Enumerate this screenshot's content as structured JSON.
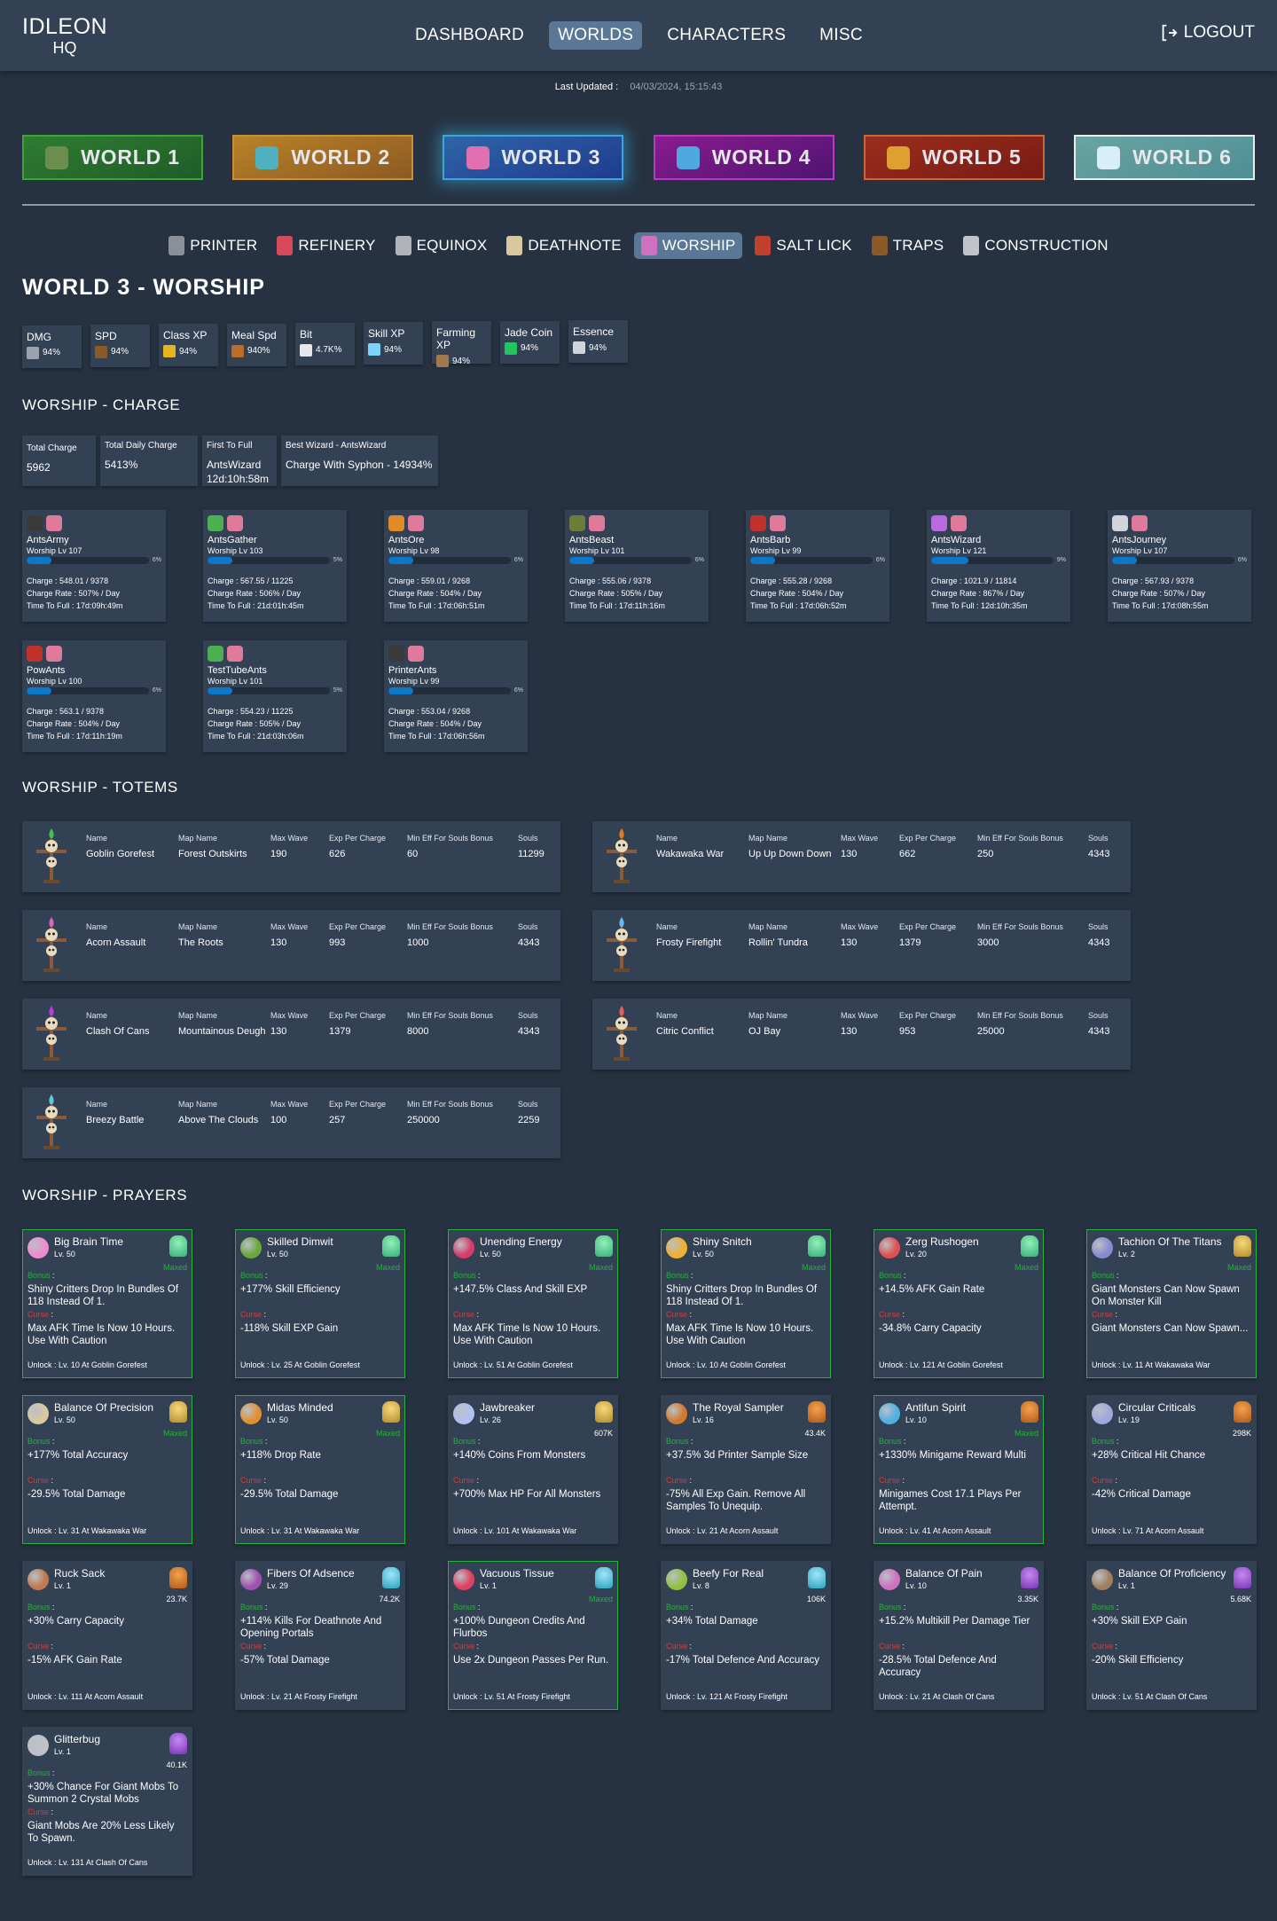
{
  "header": {
    "logo_line1": "IDLEON",
    "logo_line2": "HQ",
    "nav": [
      "DASHBOARD",
      "WORLDS",
      "CHARACTERS",
      "MISC"
    ],
    "active_nav": "WORLDS",
    "logout_label": "LOGOUT",
    "last_updated_label": "Last Updated :",
    "last_updated_value": "04/03/2024, 15:15:43"
  },
  "worlds": [
    "WORLD 1",
    "WORLD 2",
    "WORLD 3",
    "WORLD 4",
    "WORLD 5",
    "WORLD 6"
  ],
  "active_world": "WORLD 3",
  "subnav": [
    "PRINTER",
    "REFINERY",
    "EQUINOX",
    "DEATHNOTE",
    "WORSHIP",
    "SALT LICK",
    "TRAPS",
    "CONSTRUCTION"
  ],
  "active_subnav": "WORSHIP",
  "page_title": "WORLD 3 - WORSHIP",
  "bonuses": [
    {
      "label": "DMG",
      "value": "94%",
      "icon": "axe-icon",
      "color": "#9ca3af"
    },
    {
      "label": "SPD",
      "value": "94%",
      "icon": "basket-icon",
      "color": "#8b5a2b"
    },
    {
      "label": "Class XP",
      "value": "94%",
      "icon": "xp-icon",
      "color": "#e6b422"
    },
    {
      "label": "Meal Spd",
      "value": "940%",
      "icon": "meal-icon",
      "color": "#c06a2a"
    },
    {
      "label": "Bit",
      "value": "4.7K%",
      "icon": "bit-icon",
      "color": "#e5e7eb"
    },
    {
      "label": "Skill XP",
      "value": "94%",
      "icon": "skill-xp-icon",
      "color": "#7dd3fc"
    },
    {
      "label": "Farming XP",
      "value": "94%",
      "icon": "farming-icon",
      "color": "#a3784b"
    },
    {
      "label": "Jade Coin",
      "value": "94%",
      "icon": "jade-coin-icon",
      "color": "#22c55e"
    },
    {
      "label": "Essence",
      "value": "94%",
      "icon": "essence-icon",
      "color": "#d1d5db"
    }
  ],
  "charge": {
    "section_title": "WORSHIP - CHARGE",
    "summary": [
      {
        "label": "Total Charge",
        "value": "5962"
      },
      {
        "label": "Total Daily Charge",
        "value": "5413%"
      },
      {
        "label": "First To Full",
        "value": "AntsWizard",
        "value2": "12d:10h:58m"
      },
      {
        "label": "Best Wizard - AntsWizard",
        "value": "Charge With Syphon - 14934%"
      }
    ],
    "characters": [
      {
        "name": "AntsArmy",
        "level": "Worship Lv 107",
        "progress": 6,
        "pct": "6%",
        "charge": "Charge : 548.01 / 9378",
        "rate": "Charge Rate : 507% / Day",
        "full": "Time To Full : 17d:09h:49m",
        "class_color": "#3a3a3a"
      },
      {
        "name": "AntsGather",
        "level": "Worship Lv 103",
        "progress": 5,
        "pct": "5%",
        "charge": "Charge : 567.55 / 11225",
        "rate": "Charge Rate : 506% / Day",
        "full": "Time To Full : 21d:01h:45m",
        "class_color": "#4caf50"
      },
      {
        "name": "AntsOre",
        "level": "Worship Lv 98",
        "progress": 6,
        "pct": "6%",
        "charge": "Charge : 559.01 / 9268",
        "rate": "Charge Rate : 504% / Day",
        "full": "Time To Full : 17d:06h:51m",
        "class_color": "#e08a2a"
      },
      {
        "name": "AntsBeast",
        "level": "Worship Lv 101",
        "progress": 6,
        "pct": "6%",
        "charge": "Charge : 555.06 / 9378",
        "rate": "Charge Rate : 505% / Day",
        "full": "Time To Full : 17d:11h:16m",
        "class_color": "#6b7d3a"
      },
      {
        "name": "AntsBarb",
        "level": "Worship Lv 99",
        "progress": 6,
        "pct": "6%",
        "charge": "Charge : 555.28 / 9268",
        "rate": "Charge Rate : 504% / Day",
        "full": "Time To Full : 17d:06h:52m",
        "class_color": "#c2322d"
      },
      {
        "name": "AntsWizard",
        "level": "Worship Lv 121",
        "progress": 9,
        "pct": "9%",
        "charge": "Charge : 1021.9 / 11814",
        "rate": "Charge Rate : 867% / Day",
        "full": "Time To Full : 12d:10h:35m",
        "class_color": "#b86ae0"
      },
      {
        "name": "AntsJourney",
        "level": "Worship Lv 107",
        "progress": 6,
        "pct": "6%",
        "charge": "Charge : 567.93 / 9378",
        "rate": "Charge Rate : 507% / Day",
        "full": "Time To Full : 17d:08h:55m",
        "class_color": "#d1d5db"
      },
      {
        "name": "PowAnts",
        "level": "Worship Lv 100",
        "progress": 6,
        "pct": "6%",
        "charge": "Charge : 563.1 / 9378",
        "rate": "Charge Rate : 504% / Day",
        "full": "Time To Full : 17d:11h:19m",
        "class_color": "#c2322d"
      },
      {
        "name": "TestTubeAnts",
        "level": "Worship Lv 101",
        "progress": 5,
        "pct": "5%",
        "charge": "Charge : 554.23 / 11225",
        "rate": "Charge Rate : 505% / Day",
        "full": "Time To Full : 21d:03h:06m",
        "class_color": "#4caf50"
      },
      {
        "name": "PrinterAnts",
        "level": "Worship Lv 99",
        "progress": 6,
        "pct": "6%",
        "charge": "Charge : 553.04 / 9268",
        "rate": "Charge Rate : 504% / Day",
        "full": "Time To Full : 17d:06h:56m",
        "class_color": "#3a3a3a"
      }
    ]
  },
  "totems": {
    "section_title": "WORSHIP - TOTEMS",
    "headers": [
      "Name",
      "Map Name",
      "Max Wave",
      "Exp Per Charge",
      "Min Eff For Souls Bonus",
      "Souls"
    ],
    "items": [
      {
        "name": "Goblin Gorefest",
        "map": "Forest Outskirts",
        "max_wave": "190",
        "exp": "626",
        "min_eff": "60",
        "souls": "11299",
        "flame": "#3fbf5a"
      },
      {
        "name": "Wakawaka War",
        "map": "Up Up Down Down",
        "max_wave": "130",
        "exp": "662",
        "min_eff": "250",
        "souls": "4343",
        "flame": "#e07a2a"
      },
      {
        "name": "Acorn Assault",
        "map": "The Roots",
        "max_wave": "130",
        "exp": "993",
        "min_eff": "1000",
        "souls": "4343",
        "flame": "#e060c0"
      },
      {
        "name": "Frosty Firefight",
        "map": "Rollin' Tundra",
        "max_wave": "130",
        "exp": "1379",
        "min_eff": "3000",
        "souls": "4343",
        "flame": "#6ab8f0"
      },
      {
        "name": "Clash Of Cans",
        "map": "Mountainous Deugh",
        "max_wave": "130",
        "exp": "1379",
        "min_eff": "8000",
        "souls": "4343",
        "flame": "#b040e0"
      },
      {
        "name": "Citric Conflict",
        "map": "OJ Bay",
        "max_wave": "130",
        "exp": "953",
        "min_eff": "25000",
        "souls": "4343",
        "flame": "#e06060"
      },
      {
        "name": "Breezy Battle",
        "map": "Above The Clouds",
        "max_wave": "100",
        "exp": "257",
        "min_eff": "250000",
        "souls": "2259",
        "flame": "#5ac8e0"
      }
    ]
  },
  "prayers": {
    "section_title": "WORSHIP - PRAYERS",
    "bonus_label": "Bonus",
    "curse_label": "Curse",
    "unlock_label": "Unlock :",
    "maxed_label": "Maxed",
    "items": [
      {
        "name": "Big Brain Time",
        "level": "Lv. 50",
        "maxed": true,
        "cost": "Maxed",
        "soul": "green",
        "orb": "#f08ad0",
        "bonus": "Shiny Critters Drop In Bundles Of 118 Instead Of 1.",
        "curse": "Max AFK Time Is Now 10 Hours. Use With Caution",
        "unlock": "Lv. 10 At Goblin Gorefest"
      },
      {
        "name": "Skilled Dimwit",
        "level": "Lv. 50",
        "maxed": true,
        "cost": "Maxed",
        "soul": "green",
        "orb": "#6aa83a",
        "bonus": "+177% Skill Efficiency",
        "curse": "-118% Skill EXP Gain",
        "unlock": "Lv. 25 At Goblin Gorefest"
      },
      {
        "name": "Unending Energy",
        "level": "Lv. 50",
        "maxed": true,
        "cost": "Maxed",
        "soul": "green",
        "orb": "#d63c6a",
        "bonus": "+147.5% Class And Skill EXP",
        "curse": "Max AFK Time Is Now 10 Hours. Use With Caution",
        "unlock": "Lv. 51 At Goblin Gorefest"
      },
      {
        "name": "Shiny Snitch",
        "level": "Lv. 50",
        "maxed": true,
        "cost": "Maxed",
        "soul": "green",
        "orb": "#f0b030",
        "bonus": "Shiny Critters Drop In Bundles Of 118 Instead Of 1.",
        "curse": "Max AFK Time Is Now 10 Hours. Use With Caution",
        "unlock": "Lv. 10 At Goblin Gorefest"
      },
      {
        "name": "Zerg Rushogen",
        "level": "Lv. 20",
        "maxed": true,
        "cost": "Maxed",
        "soul": "green",
        "orb": "#e05050",
        "bonus": "+14.5% AFK Gain Rate",
        "curse": "-34.8% Carry Capacity",
        "unlock": "Lv. 121 At Goblin Gorefest"
      },
      {
        "name": "Tachion Of The Titans",
        "level": "Lv. 2",
        "maxed": true,
        "cost": "Maxed",
        "soul": "gold",
        "orb": "#8a8ad0",
        "bonus": "Giant Monsters Can Now Spawn On Monster Kill",
        "curse": "Giant Monsters Can Now Spawn...",
        "unlock": "Lv. 11 At Wakawaka War"
      },
      {
        "name": "Balance Of Precision",
        "level": "Lv. 50",
        "maxed": true,
        "cost": "Maxed",
        "soul": "gold",
        "orb": "#d8c8a0",
        "bonus": "+177% Total Accuracy",
        "curse": "-29.5% Total Damage",
        "unlock": "Lv. 31 At Wakawaka War"
      },
      {
        "name": "Midas Minded",
        "level": "Lv. 50",
        "maxed": true,
        "cost": "Maxed",
        "soul": "gold",
        "orb": "#e09030",
        "bonus": "+118% Drop Rate",
        "curse": "-29.5% Total Damage",
        "unlock": "Lv. 31 At Wakawaka War"
      },
      {
        "name": "Jawbreaker",
        "level": "Lv. 26",
        "maxed": false,
        "cost": "607K",
        "soul": "gold",
        "orb": "#b0c0f0",
        "bonus": "+140% Coins From Monsters",
        "curse": "+700% Max HP For All Monsters",
        "unlock": "Lv. 101 At Wakawaka War"
      },
      {
        "name": "The Royal Sampler",
        "level": "Lv. 16",
        "maxed": false,
        "cost": "43.4K",
        "soul": "orange",
        "orb": "#d07a30",
        "bonus": "+37.5% 3d Printer Sample Size",
        "curse": "-75% All Exp Gain. Remove All Samples To Unequip.",
        "unlock": "Lv. 21 At Acorn Assault"
      },
      {
        "name": "Antifun Spirit",
        "level": "Lv. 10",
        "maxed": true,
        "cost": "Maxed",
        "soul": "orange",
        "orb": "#50b0e0",
        "bonus": "+1330% Minigame Reward Multi",
        "curse": "Minigames Cost 17.1 Plays Per Attempt.",
        "unlock": "Lv. 41 At Acorn Assault"
      },
      {
        "name": "Circular Criticals",
        "level": "Lv. 19",
        "maxed": false,
        "cost": "298K",
        "soul": "orange",
        "orb": "#a0a8e0",
        "bonus": "+28% Critical Hit Chance",
        "curse": "-42% Critical Damage",
        "unlock": "Lv. 71 At Acorn Assault"
      },
      {
        "name": "Ruck Sack",
        "level": "Lv. 1",
        "maxed": false,
        "cost": "23.7K",
        "soul": "orange",
        "orb": "#c07a50",
        "bonus": "+30% Carry Capacity",
        "curse": "-15% AFK Gain Rate",
        "unlock": "Lv. 111 At Acorn Assault"
      },
      {
        "name": "Fibers Of Adsence",
        "level": "Lv. 29",
        "maxed": false,
        "cost": "74.2K",
        "soul": "blue",
        "orb": "#a050b0",
        "bonus": "+114% Kills For Deathnote And Opening Portals",
        "curse": "-57% Total Damage",
        "unlock": "Lv. 21 At Frosty Firefight"
      },
      {
        "name": "Vacuous Tissue",
        "level": "Lv. 1",
        "maxed": true,
        "cost": "Maxed",
        "soul": "blue",
        "orb": "#e04060",
        "bonus": "+100% Dungeon Credits And Flurbos",
        "curse": "Use 2x Dungeon Passes Per Run.",
        "unlock": "Lv. 51 At Frosty Firefight"
      },
      {
        "name": "Beefy For Real",
        "level": "Lv. 8",
        "maxed": false,
        "cost": "106K",
        "soul": "blue",
        "orb": "#90c040",
        "bonus": "+34% Total Damage",
        "curse": "-17% Total Defence And Accuracy",
        "unlock": "Lv. 121 At Frosty Firefight"
      },
      {
        "name": "Balance Of Pain",
        "level": "Lv. 10",
        "maxed": false,
        "cost": "3.35K",
        "soul": "purple",
        "orb": "#d070c0",
        "bonus": "+15.2% Multikill Per Damage Tier",
        "curse": "-28.5% Total Defence And Accuracy",
        "unlock": "Lv. 21 At Clash Of Cans"
      },
      {
        "name": "Balance Of Proficiency",
        "level": "Lv. 1",
        "maxed": false,
        "cost": "5.68K",
        "soul": "purple",
        "orb": "#a08060",
        "bonus": "+30% Skill EXP Gain",
        "curse": "-20% Skill Efficiency",
        "unlock": "Lv. 51 At Clash Of Cans"
      },
      {
        "name": "Glitterbug",
        "level": "Lv. 1",
        "maxed": false,
        "cost": "40.1K",
        "soul": "purple",
        "orb": "#c0c0c8",
        "bonus": "+30% Chance For Giant Mobs To Summon 2 Crystal Mobs",
        "curse": "Giant Mobs Are 20% Less Likely To Spawn.",
        "unlock": "Lv. 131 At Clash Of Cans"
      }
    ]
  }
}
